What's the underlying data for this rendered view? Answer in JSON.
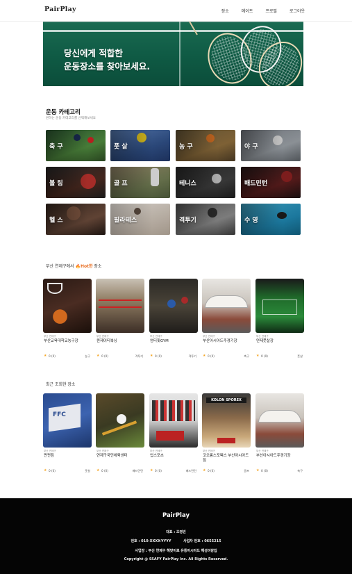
{
  "header": {
    "logo": "PairPlay",
    "nav": [
      "장소",
      "메이트",
      "프로필",
      "로그아웃"
    ]
  },
  "hero": {
    "line1": "당신에게 적합한",
    "line2": "운동장소를 찾아보세요."
  },
  "categories_section": {
    "title": "운동 카테고리",
    "subtitle": "원하는 운동 카테고리를 선택해보세요",
    "items": [
      {
        "label": "축 구",
        "icon": "soccer"
      },
      {
        "label": "풋 살",
        "icon": "futsal"
      },
      {
        "label": "농 구",
        "icon": "basketball"
      },
      {
        "label": "야 구",
        "icon": "baseball"
      },
      {
        "label": "볼 링",
        "icon": "bowling"
      },
      {
        "label": "골 프",
        "icon": "golf"
      },
      {
        "label": "테니스",
        "icon": "tennis"
      },
      {
        "label": "배드민턴",
        "icon": "badminton"
      },
      {
        "label": "헬 스",
        "icon": "gym"
      },
      {
        "label": "필라테스",
        "icon": "pilates"
      },
      {
        "label": "격투기",
        "icon": "martial-arts"
      },
      {
        "label": "수 영",
        "icon": "swimming"
      }
    ]
  },
  "hot_section": {
    "prefix": "부산 연제구에서 ",
    "hot_word": "Hot한",
    "suffix": " 장소",
    "places": [
      {
        "addr": "부산 연제구",
        "name": "부산교육대학교농구장",
        "rating": "0 (0)",
        "tag": "농구"
      },
      {
        "addr": "부산 연제구",
        "name": "퀸제이티복싱",
        "rating": "0 (0)",
        "tag": "격투기"
      },
      {
        "addr": "부산 연제구",
        "name": "엄티핏GYM",
        "rating": "0 (0)",
        "tag": "격투기"
      },
      {
        "addr": "부산 연제구",
        "name": "부산아시아드주경기장",
        "rating": "0 (0)",
        "tag": "축구"
      },
      {
        "addr": "부산 연제구",
        "name": "연제풋살장",
        "rating": "0 (0)",
        "tag": "풋살"
      }
    ]
  },
  "recent_section": {
    "title": "최근 조회한 장소",
    "places": [
      {
        "addr": "부산 연제구",
        "name": "펀펀짐",
        "rating": "0 (0)",
        "tag": "풋살"
      },
      {
        "addr": "부산 연제구",
        "name": "연제구국민체육센터",
        "rating": "0 (0)",
        "tag": "배드민턴"
      },
      {
        "addr": "부산 연제구",
        "name": "업스포츠",
        "rating": "0 (0)",
        "tag": "배드민턴"
      },
      {
        "addr": "부산 연제구",
        "name": "코오롱스포렉스 부산아시아드점",
        "rating": "0 (0)",
        "tag": "골프"
      },
      {
        "addr": "부산 연제구",
        "name": "부산아시아드주경기장",
        "rating": "0 (0)",
        "tag": "축구"
      }
    ]
  },
  "footer": {
    "logo": "PairPlay",
    "ceo": "대표 : 조영빈",
    "phone": "번호 : 010-XXXX-YYYY",
    "biz": "사업자 번호 : 0655215",
    "address": "사업장 : 부산 연제구 해맞이로 유통아시아드 해성이랑집",
    "copyright": "Copyright @ SSAFY PairPlay Inc. All Rights Reserved."
  },
  "colors": {
    "accent": "#e86a1c",
    "star": "#f5a623",
    "hero_green": "#0f5a44",
    "footer_bg": "#050505"
  }
}
